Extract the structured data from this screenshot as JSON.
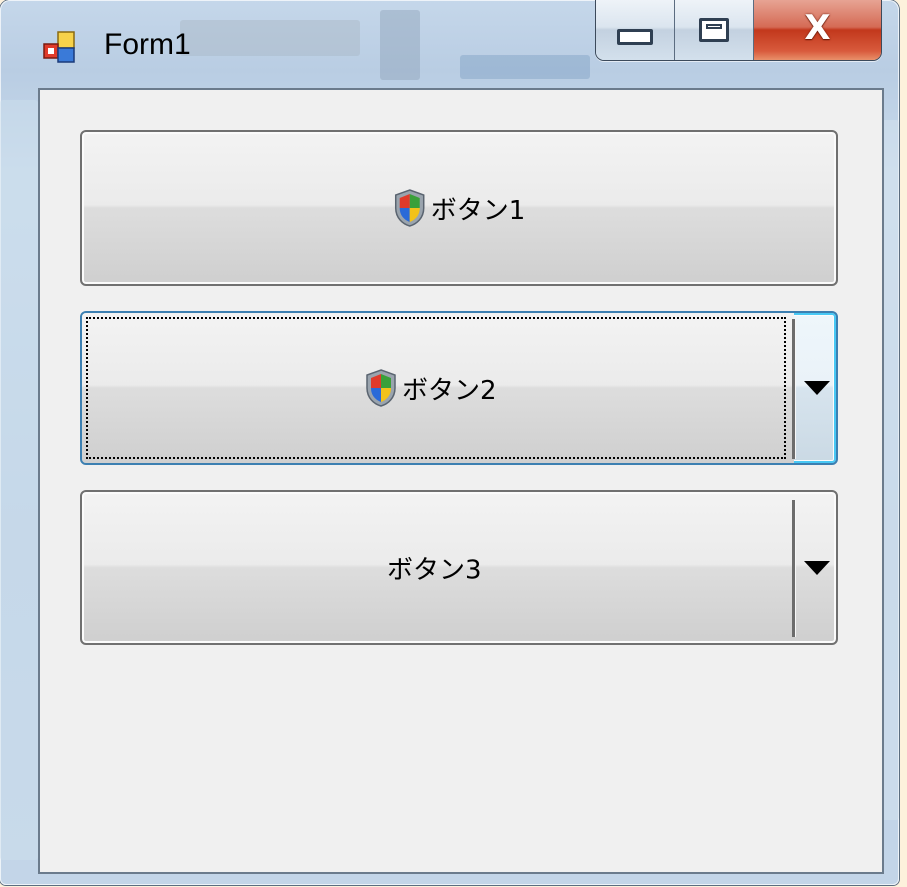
{
  "window": {
    "title": "Form1",
    "minimize_label": "minimize",
    "maximize_label": "maximize",
    "close_label": "close"
  },
  "buttons": [
    {
      "label": "ボタン1",
      "icon": "uac-shield-icon",
      "split": false
    },
    {
      "label": "ボタン2",
      "icon": "uac-shield-icon",
      "split": true,
      "focused": true
    },
    {
      "label": "ボタン3",
      "icon": null,
      "split": true
    }
  ],
  "colors": {
    "client_bg": "#f0f0f0",
    "focus_border": "#48c8f4",
    "close_red": "#c2381c"
  }
}
